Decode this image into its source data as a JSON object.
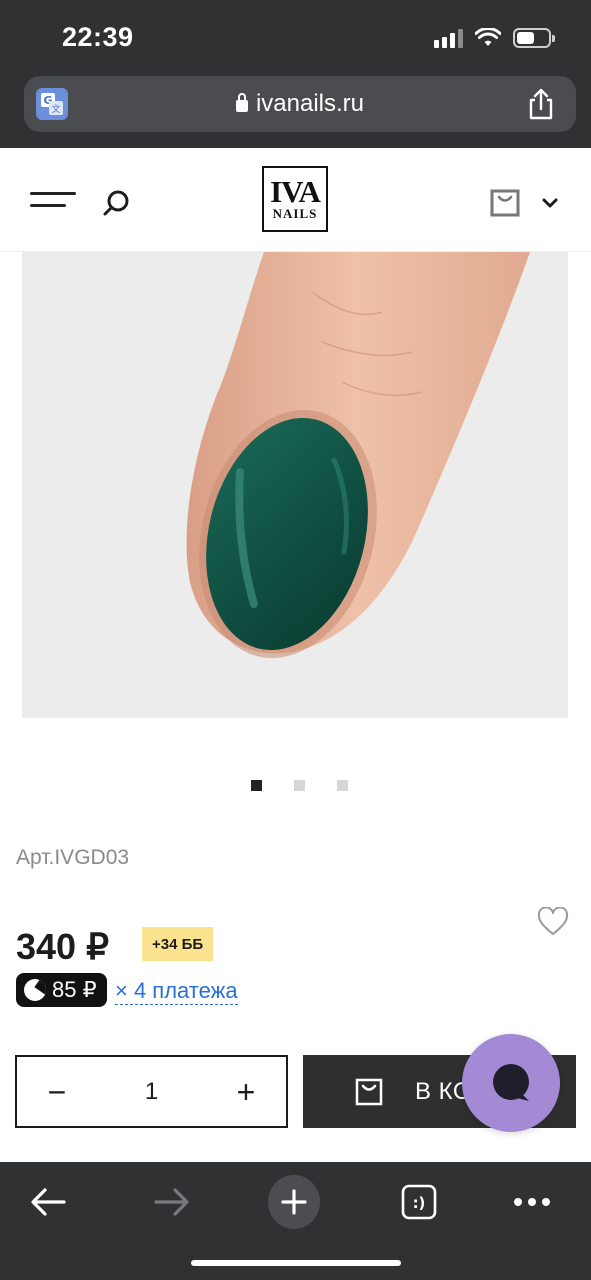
{
  "status_bar": {
    "time": "22:39"
  },
  "browser": {
    "url": "ivanails.ru",
    "icons": [
      "translate-icon",
      "lock-icon",
      "share-icon"
    ]
  },
  "site_header": {
    "logo_line1": "IVA",
    "logo_line2": "NAILS",
    "icons": [
      "menu-icon",
      "search-icon",
      "bag-icon",
      "chevron-down-icon"
    ]
  },
  "product": {
    "image_alt_icon": "nail-photo",
    "gallery_total": 3,
    "gallery_active": 1,
    "sku": "Арт.IVGD03",
    "price": "340 ₽",
    "bonus": "+34 ББ",
    "split_amount": "85 ₽",
    "split_text": "× 4 платежа",
    "quantity": "1",
    "qty_minus": "−",
    "qty_plus": "+",
    "cart_label": "В КОРЗИНУ",
    "colors": {
      "nail": "#0f4f41",
      "skin": "#e6b39a",
      "bonus": "#fbe28e",
      "chat": "#a48ad4"
    }
  },
  "toolbar": {
    "icons": [
      "back-arrow-icon",
      "forward-arrow-icon",
      "new-tab-plus-icon",
      "tabs-icon",
      "more-icon"
    ],
    "tabs_glyph": ":)"
  }
}
